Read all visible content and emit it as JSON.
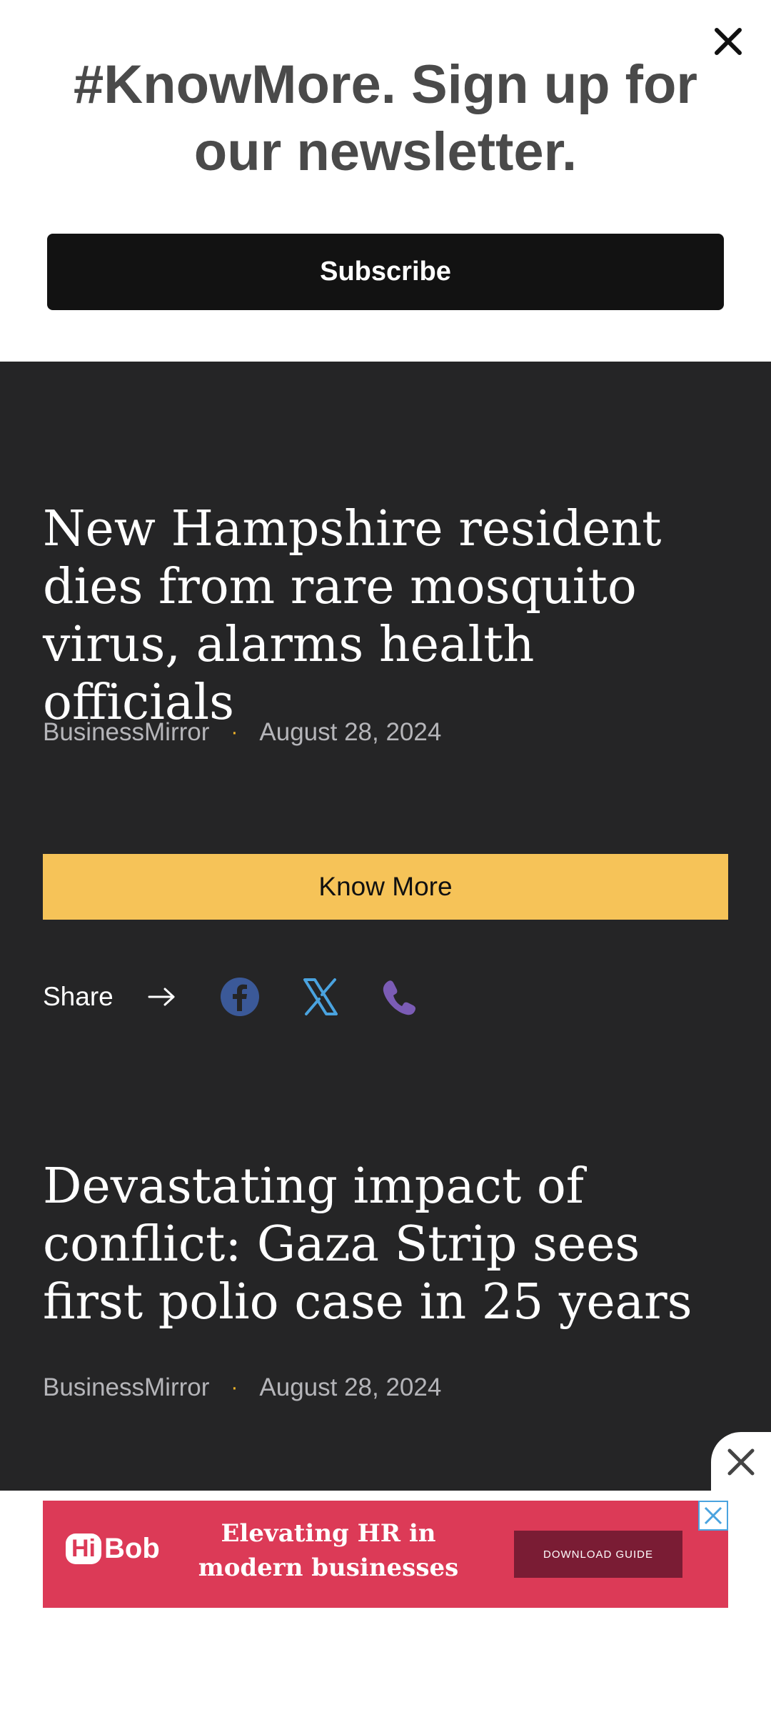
{
  "newsletter": {
    "title": "#KnowMore. Sign up for our newsletter.",
    "subscribe_label": "Subscribe"
  },
  "articles": [
    {
      "headline": "New Hampshire resident dies from rare mosquito virus, alarms health officials",
      "source": "BusinessMirror",
      "separator": "·",
      "date": "August 28, 2024"
    },
    {
      "headline": "Devastating impact of conflict: Gaza Strip sees first polio case in 25 years",
      "source": "BusinessMirror",
      "separator": "·",
      "date": "August 28, 2024"
    }
  ],
  "know_more_label": "Know More",
  "share": {
    "label": "Share",
    "icons": [
      "facebook-icon",
      "x-twitter-icon",
      "phone-icon"
    ]
  },
  "ad": {
    "brand": "Bob",
    "brand_prefix": "Hi",
    "text": "Elevating HR in modern businesses",
    "cta": "DOWNLOAD GUIDE"
  },
  "colors": {
    "feed_bg": "#252526",
    "accent_yellow": "#f6c358",
    "facebook": "#3b5998",
    "x_blue": "#4aa3df",
    "phone_purple": "#7b5cb5",
    "ad_bg": "#dc3a57"
  }
}
